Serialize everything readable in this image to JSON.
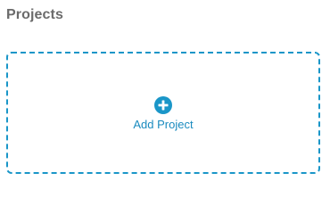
{
  "header": {
    "title": "Projects"
  },
  "add_project": {
    "label": "Add Project",
    "icon": "plus-circle-icon",
    "accent_color": "#1a96c8"
  }
}
